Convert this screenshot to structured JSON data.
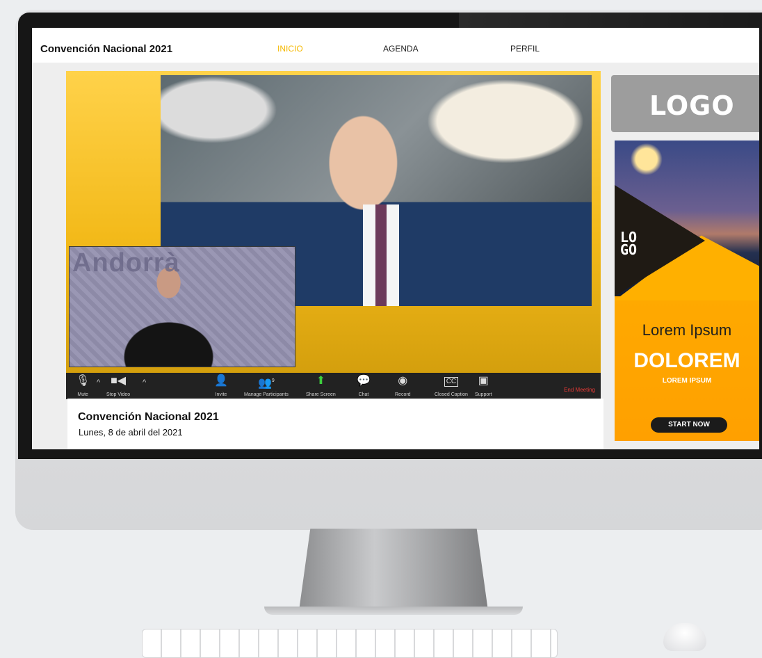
{
  "header": {
    "site_title": "Convención Nacional 2021",
    "nav": [
      "INICIO",
      "AGENDA",
      "PERFIL"
    ],
    "active_nav": "INICIO",
    "accent_color": "#f5b800"
  },
  "video": {
    "pip_text": "Andorrà",
    "toolbar": {
      "mute": "Mute",
      "stop_video": "Stop Video",
      "invite": "Invite",
      "manage_participants": "Manage Participants",
      "participants_count": "9",
      "share_screen": "Share Screen",
      "chat": "Chat",
      "record": "Record",
      "closed_caption": "Closed Caption",
      "support": "Support",
      "end_meeting": "End Meeting"
    },
    "icons": [
      "microphone-icon",
      "video-camera-icon",
      "invite-icon",
      "participants-icon",
      "share-screen-icon",
      "chat-icon",
      "record-icon",
      "closed-caption-icon",
      "support-icon"
    ]
  },
  "event": {
    "title": "Convención Nacional 2021",
    "date": "Lunes, 8 de abril del 2021"
  },
  "sidebar": {
    "logo": "LOGO",
    "ad": {
      "logo_line1": "LO",
      "logo_line2": "GO",
      "headline": "Lorem Ipsum",
      "big": "DOLOREM",
      "small": "LOREM IPSUM",
      "button": "START NOW"
    }
  }
}
